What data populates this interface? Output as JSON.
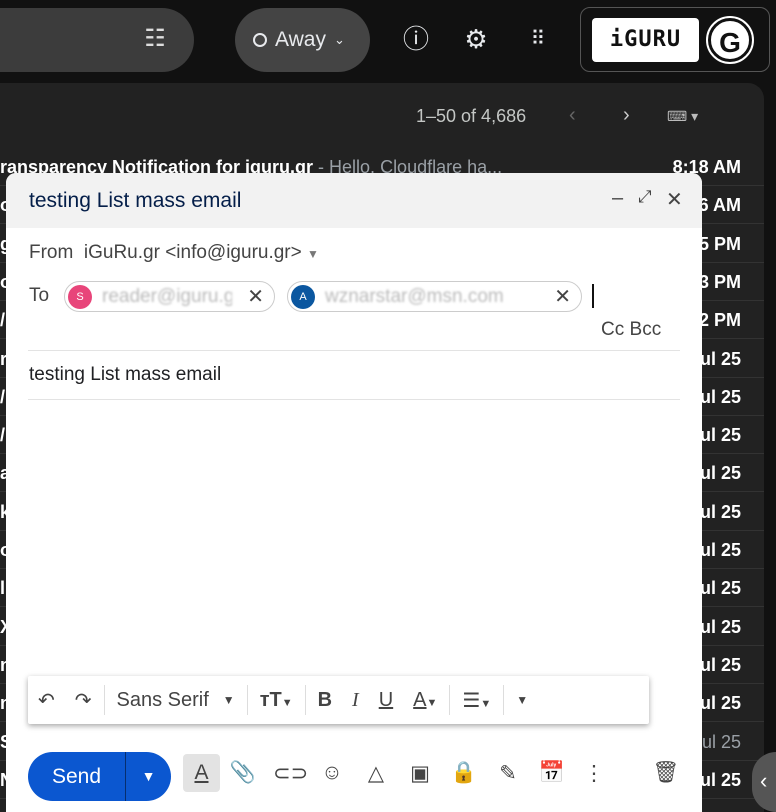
{
  "header": {
    "status": "Away",
    "icons": [
      "filter-icon",
      "help-icon",
      "settings-icon",
      "apps-icon"
    ],
    "logo": "iGURU",
    "avatar_letter": "G"
  },
  "list": {
    "pager": "1–50 of 4,686",
    "rows": [
      {
        "subject": "ransparency Notification for iguru.gr",
        "snippet": " - Hello, Cloudflare ha...",
        "time": "8:18 AM",
        "read": false
      },
      {
        "subject": "o",
        "snippet": "",
        "time": "6 AM",
        "read": false
      },
      {
        "subject": "g",
        "snippet": "",
        "time": "5 PM",
        "read": false
      },
      {
        "subject": "o",
        "snippet": "",
        "time": "3 PM",
        "read": false
      },
      {
        "subject": "/",
        "snippet": "",
        "time": "2 PM",
        "read": false
      },
      {
        "subject": "r",
        "snippet": "",
        "time": "ul 25",
        "read": false
      },
      {
        "subject": "/",
        "snippet": "",
        "time": "ul 25",
        "read": false
      },
      {
        "subject": "/",
        "snippet": "",
        "time": "ul 25",
        "read": false
      },
      {
        "subject": "a",
        "snippet": "",
        "time": "ul 25",
        "read": false
      },
      {
        "subject": "k",
        "snippet": "",
        "time": "ul 25",
        "read": false
      },
      {
        "subject": "o",
        "snippet": "",
        "time": "ul 25",
        "read": false
      },
      {
        "subject": "l",
        "snippet": "",
        "time": "ul 25",
        "read": false
      },
      {
        "subject": "X",
        "snippet": "",
        "time": "ul 25",
        "read": false
      },
      {
        "subject": "n",
        "snippet": "",
        "time": "ul 25",
        "read": false
      },
      {
        "subject": "n",
        "snippet": "",
        "time": "ul 25",
        "read": false
      },
      {
        "subject": "S",
        "snippet": "",
        "time": "ul 25",
        "read": true
      },
      {
        "subject": "N",
        "snippet": "",
        "time": "ul 25",
        "read": false
      }
    ]
  },
  "compose": {
    "title": "testing List mass email",
    "from_label": "From",
    "from_value": "iGuRu.gr <info@iguru.gr>",
    "to_label": "To",
    "recipients": [
      {
        "initial": "S",
        "email": "reader@iguru.gr",
        "color": "#e8457a"
      },
      {
        "initial": "A",
        "email": "wznarstar@msn.com",
        "color": "#0b57a0"
      }
    ],
    "cc": "Cc",
    "bcc": "Bcc",
    "subject": "testing List mass email",
    "font": "Sans Serif",
    "send": "Send"
  }
}
